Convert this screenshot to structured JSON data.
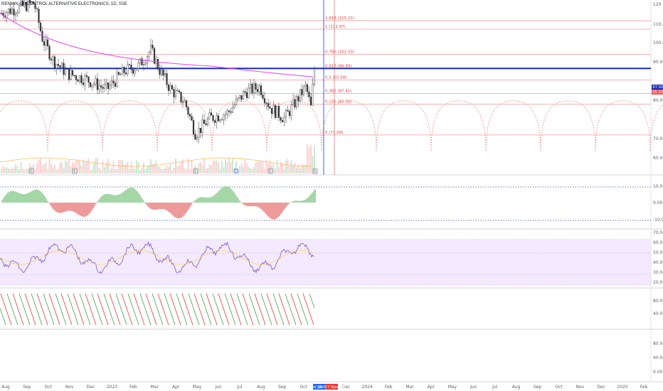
{
  "symbol_title": "RENMIN UNICONTROL ALTERNATIVE ELECTRONICS, 1D, SSE",
  "colors": {
    "up": "#26a69a",
    "down": "#ef5350",
    "ma": "#e040fb",
    "fib_line": "#ef9a9a",
    "blue_line": "#1a2bbd",
    "rsi_band": "#e9d5ff",
    "rsi_line": "#7e57c2",
    "osc_up": "#a5d6a7",
    "osc_down": "#ef9a9a",
    "stoch_k": "#e53935",
    "stoch_d": "#43a047"
  },
  "fib_levels": [
    {
      "label": "1.618 (115.21)",
      "price": 115.21
    },
    {
      "label": "1 (111.97)",
      "price": 111.97
    },
    {
      "label": "0.786 (102.33)",
      "price": 102.33
    },
    {
      "label": "0.618 (96.89)",
      "price": 96.89
    },
    {
      "label": "0.5 (92.58)",
      "price": 92.58
    },
    {
      "label": "0.382 (87.45)",
      "price": 87.45
    },
    {
      "label": "0.236 (83.32)",
      "price": 83.32
    },
    {
      "label": "0 (71.59)",
      "price": 71.59
    }
  ],
  "right_axis": {
    "main": [
      "120",
      "110.00",
      "100.00",
      "90.00",
      "80.00",
      "70.00",
      "60.00"
    ],
    "osc": [
      "10.00",
      "0.00",
      "-10.00"
    ],
    "rsi": [
      "70.00",
      "60.00",
      "50.00",
      "40.00",
      "30.00",
      "20.00"
    ],
    "stoch": [
      "80.00%",
      "40.00%"
    ],
    "extra": [
      "80.00",
      "40.00",
      "0.00"
    ]
  },
  "price_tags": [
    {
      "text": "97.00",
      "color": "#1a2bbd"
    },
    {
      "text": "95.10",
      "color": "#ef5350"
    }
  ],
  "time_axis": [
    "Aug",
    "Sep",
    "Oct",
    "Nov",
    "Dec",
    "2023",
    "Feb",
    "Mar",
    "Apr",
    "May",
    "Jun",
    "Jul",
    "Aug",
    "Sep",
    "Oct",
    "Nov",
    "Dec",
    "2024",
    "Feb",
    "Mar",
    "Apr",
    "May",
    "Jun",
    "Jul",
    "Aug",
    "Sep",
    "Oct",
    "Nov",
    "Dec",
    "2025",
    "Feb"
  ],
  "time_badges": [
    {
      "text": "Wed 08 Nov",
      "color": "#2962ff"
    },
    {
      "text": "Jan 27 Nov '23",
      "color": "#e53935"
    }
  ],
  "event_markers": [
    "E",
    "E",
    "E",
    "D",
    "E",
    "E"
  ]
}
